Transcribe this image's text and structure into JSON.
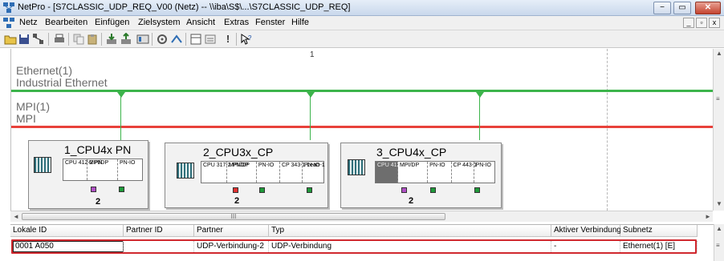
{
  "window": {
    "title": "NetPro - [S7CLASSIC_UDP_REQ_V00 (Netz) -- \\\\iba\\S$\\...\\S7CLASSIC_UDP_REQ]",
    "minimize": "−",
    "maximize": "▭",
    "close": "✕"
  },
  "menubar": {
    "items": [
      "Netz",
      "Bearbeiten",
      "Einfügen",
      "Zielsystem",
      "Ansicht",
      "Extras",
      "Fenster",
      "Hilfe"
    ],
    "mdi_min": "_",
    "mdi_max": "▫",
    "mdi_close": "x"
  },
  "toolbar": {
    "icons": [
      "open-folder-icon",
      "save-icon",
      "network-icon",
      "print-icon",
      "copy-icon",
      "paste-icon",
      "download-icon",
      "upload-icon",
      "configure-icon",
      "tool-icon",
      "connection-icon",
      "view-icon",
      "properties-icon",
      "alert-icon",
      "help-icon"
    ],
    "alert_glyph": "!",
    "help_glyph": "✦?"
  },
  "network": {
    "column_marker": "1",
    "ethernet": {
      "name": "Ethernet(1)",
      "type": "Industrial Ethernet",
      "color": "#3cb44b"
    },
    "mpi": {
      "name": "MPI(1)",
      "type": "MPI",
      "color": "#e8413a"
    },
    "stations": [
      {
        "name": "1_CPU4x PN",
        "slots": [
          "CPU 412-2 PN",
          "MPI/DP",
          "PN-IO"
        ],
        "number": "2"
      },
      {
        "name": "2_CPU3x_CP",
        "slots": [
          "CPU 317-2 PN/DP",
          "MPI/DP",
          "PN-IO",
          "CP 343-1 Lean",
          "PN-IO-1"
        ],
        "number": "2"
      },
      {
        "name": "3_CPU4x_CP",
        "slots": [
          "CPU 412-2 PN",
          "MPI/DP",
          "PN-IO",
          "CP 443-1",
          "PN-IO"
        ],
        "number": "2"
      }
    ],
    "scroll_thumb_label": "III",
    "port_colors": {
      "mpi": "#b04fc6",
      "ethernet": "#1f9a3a",
      "alert": "#e03030"
    }
  },
  "connections": {
    "headers": [
      "Lokale ID",
      "Partner ID",
      "Partner",
      "Typ",
      "Aktiver Verbindung",
      "Subnetz"
    ],
    "rows": [
      {
        "local_id": "0001 A050",
        "partner_id": "",
        "partner": "UDP-Verbindung-2",
        "type": "UDP-Verbindung",
        "active": "-",
        "subnet": "Ethernet(1) [E]"
      }
    ]
  }
}
